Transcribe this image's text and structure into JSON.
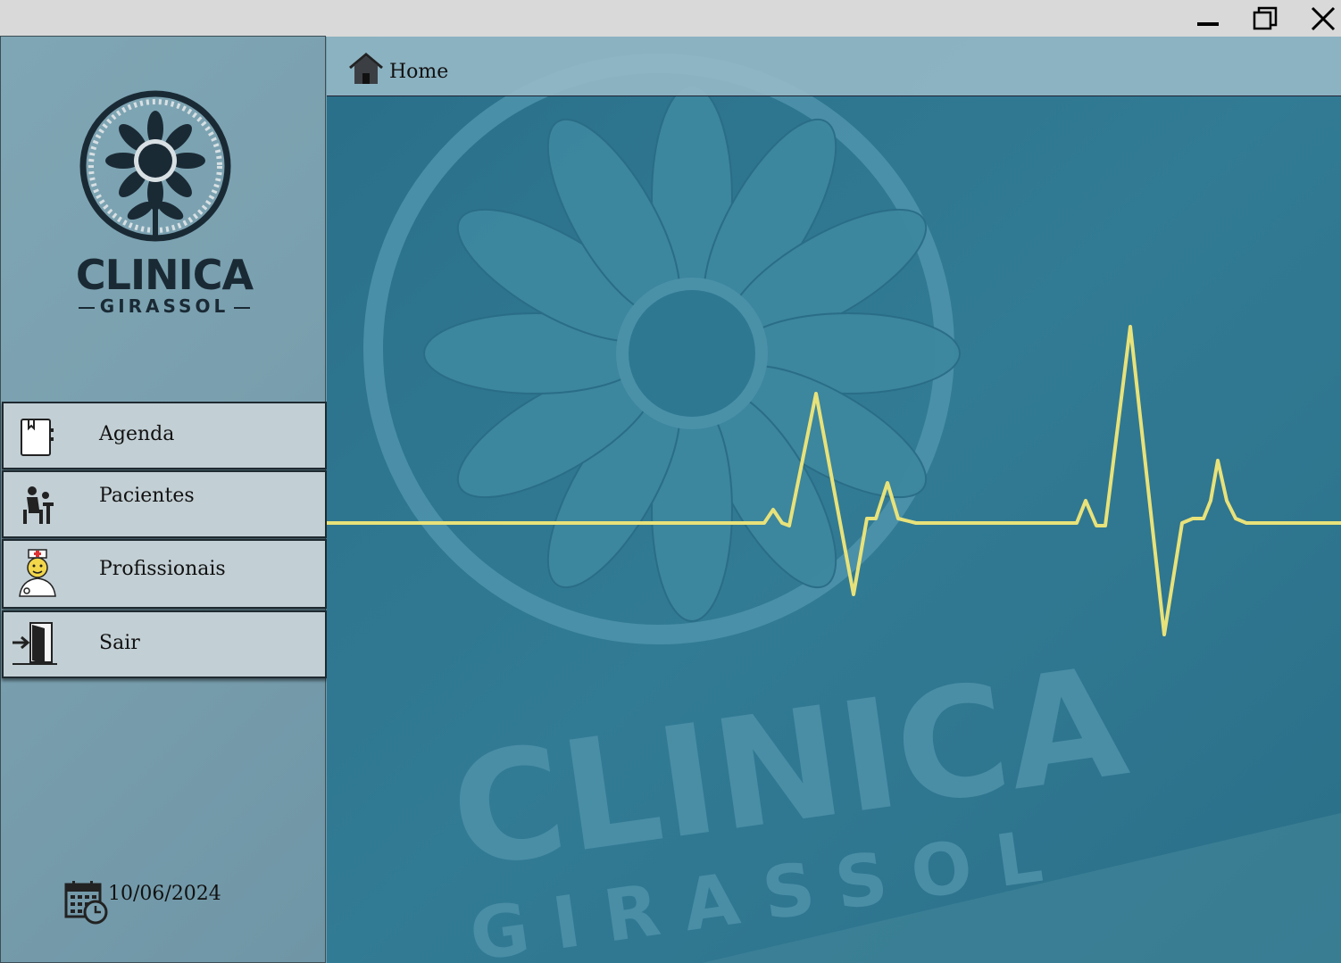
{
  "window": {
    "minimize_icon": "minimize-icon",
    "maximize_icon": "restore-icon",
    "close_icon": "close-icon"
  },
  "logo": {
    "title": "CLINICA",
    "subtitle": "GIRASSOL"
  },
  "nav": {
    "items": [
      {
        "label": "Agenda",
        "icon": "agenda-book-icon"
      },
      {
        "label": "Pacientes",
        "icon": "patient-icon"
      },
      {
        "label": "Profissionais",
        "icon": "doctor-icon"
      },
      {
        "label": "Sair",
        "icon": "exit-door-icon"
      }
    ]
  },
  "footer": {
    "date": "10/06/2024",
    "icon": "calendar-clock-icon"
  },
  "header": {
    "title": "Home",
    "icon": "home-icon"
  },
  "background": {
    "brand_title": "CLINICA",
    "brand_subtitle": "GIRASSOL",
    "accent_color": "#e8e27a",
    "base_color": "#2f7892"
  }
}
